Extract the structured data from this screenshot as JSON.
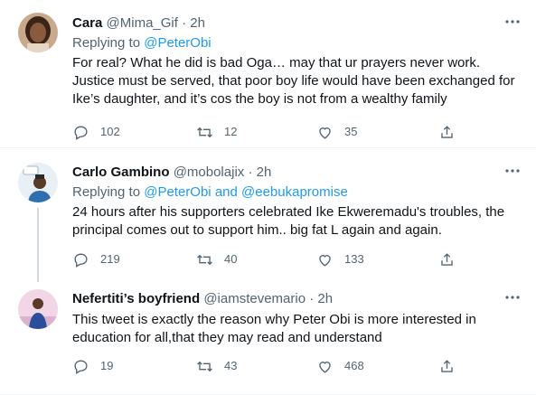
{
  "tweets": [
    {
      "name": "Cara",
      "handle": "@Mima_Gif",
      "sep": "·",
      "time": "2h",
      "replying_prefix": "Replying to",
      "replying_to": "@PeterObi",
      "replying_and": "",
      "replying_to_2": "",
      "text": "For real? What he did is bad Oga… may that ur prayers never work. Justice must be served, that poor boy life would have been exchanged for Ike’s daughter, and it’s cos the boy is not from a wealthy family",
      "replies": "102",
      "retweets": "12",
      "likes": "35"
    },
    {
      "name": "Carlo Gambino",
      "handle": "@mobolajix",
      "sep": "·",
      "time": "2h",
      "replying_prefix": "Replying to",
      "replying_to": "@PeterObi",
      "replying_and": "and",
      "replying_to_2": "@eebukapromise",
      "text": "24 hours after his supporters celebrated Ike Ekweremadu's troubles, the principal comes out to support him.. big fat L again and again.",
      "replies": "219",
      "retweets": "40",
      "likes": "133"
    },
    {
      "name": "Nefertiti’s boyfriend",
      "handle": "@iamstevemario",
      "sep": "·",
      "time": "2h",
      "replying_prefix": "",
      "replying_to": "",
      "replying_and": "",
      "replying_to_2": "",
      "text": "This tweet is exactly the reason why Peter Obi is more interested in education for all,that they may read and understand",
      "replies": "19",
      "retweets": "43",
      "likes": "468"
    }
  ],
  "icons": {
    "more": "more-icon",
    "reply": "reply-icon",
    "retweet": "retweet-icon",
    "like": "like-icon",
    "share": "share-icon"
  },
  "colors": {
    "link": "#1d9bf0",
    "secondary_text": "#536471",
    "primary_text": "#0f1419",
    "divider": "#eff3f4",
    "thread_line": "#cfd9de"
  }
}
